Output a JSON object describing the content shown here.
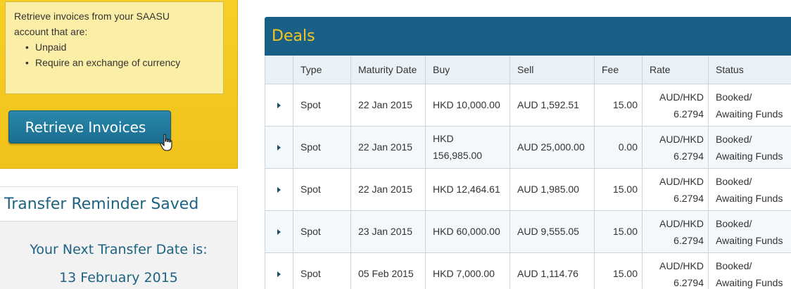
{
  "invoice_panel": {
    "intro_line1": "Retrieve invoices from your SAASU",
    "intro_line2": "account that are:",
    "bullets": [
      "Unpaid",
      "Require an exchange of currency"
    ],
    "button_label": "Retrieve Invoices"
  },
  "reminder": {
    "title": "Transfer Reminder Saved",
    "next_label": "Your Next Transfer Date is:",
    "next_date": "13 February 2015"
  },
  "deals": {
    "title": "Deals",
    "columns": [
      "Type",
      "Maturity Date",
      "Buy",
      "Sell",
      "Fee",
      "Rate",
      "Status"
    ],
    "rows": [
      {
        "type": "Spot",
        "maturity": "22 Jan 2015",
        "buy": "HKD 10,000.00",
        "sell": "AUD 1,592.51",
        "fee": "15.00",
        "rate_pair": "AUD/HKD",
        "rate_value": "6.2794",
        "status_1": "Booked/",
        "status_2": "Awaiting Funds"
      },
      {
        "type": "Spot",
        "maturity": "22 Jan 2015",
        "buy_1": "HKD",
        "buy_2": "156,985.00",
        "sell": "AUD 25,000.00",
        "fee": "0.00",
        "rate_pair": "AUD/HKD",
        "rate_value": "6.2794",
        "status_1": "Booked/",
        "status_2": "Awaiting Funds"
      },
      {
        "type": "Spot",
        "maturity": "22 Jan 2015",
        "buy": "HKD 12,464.61",
        "sell": "AUD 1,985.00",
        "fee": "15.00",
        "rate_pair": "AUD/HKD",
        "rate_value": "6.2794",
        "status_1": "Booked/",
        "status_2": "Awaiting Funds"
      },
      {
        "type": "Spot",
        "maturity": "23 Jan 2015",
        "buy": "HKD 60,000.00",
        "sell": "AUD 9,555.05",
        "fee": "15.00",
        "rate_pair": "AUD/HKD",
        "rate_value": "6.2794",
        "status_1": "Booked/",
        "status_2": "Awaiting Funds"
      },
      {
        "type": "Spot",
        "maturity": "05 Feb 2015",
        "buy": "HKD 7,000.00",
        "sell": "AUD 1,114.76",
        "fee": "15.00",
        "rate_pair": "AUD/HKD",
        "rate_value": "6.2794",
        "status_1": "Booked/",
        "status_2": "Awaiting Funds"
      }
    ]
  },
  "colors": {
    "panel_yellow": "#f6cf25",
    "deals_header": "#1a5f86",
    "deals_title": "#f6c623",
    "accent_blue": "#1d6384"
  }
}
